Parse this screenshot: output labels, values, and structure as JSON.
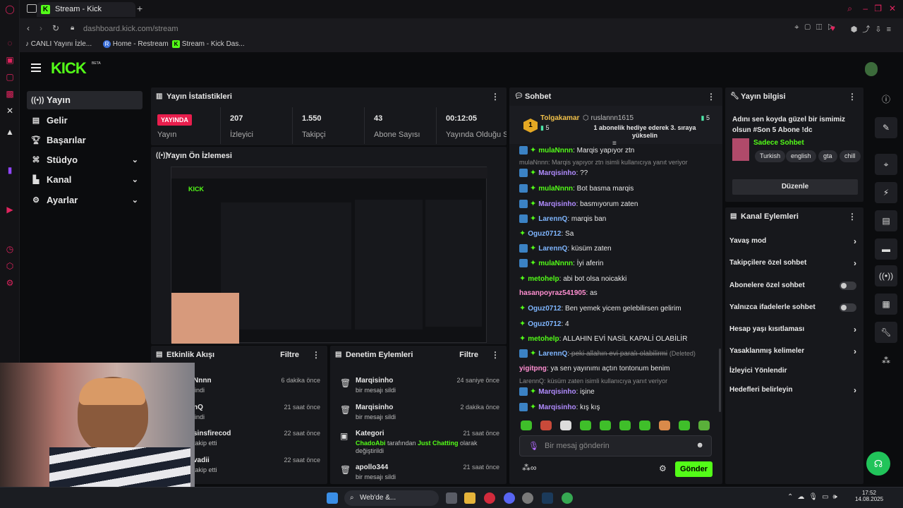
{
  "browser": {
    "tab_title": "Stream - Kick Dashboard",
    "url_host": "dashboard.kick.com",
    "url_path": "/stream",
    "bookmarks": [
      "CANLI Yayını İzle...",
      "Home - Restream",
      "Stream - Kick Das..."
    ]
  },
  "kick": {
    "logo": "KICK",
    "beta": "BETA"
  },
  "nav": {
    "items": [
      {
        "label": "Yayın",
        "icon": "broadcast-icon"
      },
      {
        "label": "Gelir",
        "icon": "revenue-icon"
      },
      {
        "label": "Başarılar",
        "icon": "trophy-icon"
      },
      {
        "label": "Stüdyo",
        "icon": "studio-icon"
      },
      {
        "label": "Kanal",
        "icon": "channel-icon"
      },
      {
        "label": "Ayarlar",
        "icon": "gear-icon"
      }
    ]
  },
  "stats": {
    "title": "Yayın İstatistikleri",
    "live_badge": "YAYINDA",
    "items": [
      {
        "value": "",
        "label": "Yayın"
      },
      {
        "value": "207",
        "label": "İzleyici"
      },
      {
        "value": "1.550",
        "label": "Takipçi"
      },
      {
        "value": "43",
        "label": "Abone Sayısı"
      },
      {
        "value": "00:12:05",
        "label": "Yayında Olduğu Süre"
      }
    ]
  },
  "preview": {
    "title": "Yayın Ön İzlemesi"
  },
  "activity": {
    "title": "Etkinlik Akışı",
    "filter": "Filtre",
    "rows": [
      {
        "name": "Nnnn",
        "sub": "lindi",
        "time": "6 dakika önce"
      },
      {
        "name": "nQ",
        "sub": "lindi",
        "time": "21 saat önce"
      },
      {
        "name": "sinsfirecod",
        "sub": "takip etti",
        "time": "22 saat önce"
      },
      {
        "name": "vadii",
        "sub": "takip etti",
        "time": "22 saat önce"
      }
    ]
  },
  "moderation": {
    "title": "Denetim Eylemleri",
    "filter": "Filtre",
    "rows": [
      {
        "name": "Marqisinho",
        "sub": "bir mesajı sildi",
        "time": "24 saniye önce"
      },
      {
        "name": "Marqisinho",
        "sub": "bir mesajı sildi",
        "time": "2 dakika önce"
      },
      {
        "name": "Kategori",
        "sub_user": "ChadoAbi",
        "sub_mid": " tarafından ",
        "sub_cat": "Just Chatting",
        "sub_end": " olarak değiştirildi",
        "time": "21 saat önce"
      },
      {
        "name": "apollo344",
        "sub": "bir mesajı sildi",
        "time": "21 saat önce"
      }
    ]
  },
  "chat": {
    "title": "Sohbet",
    "gifter": {
      "rank": "1",
      "name": "Tolgakamar",
      "count": "5"
    },
    "gift_user": "ruslannn1615",
    "gift_count": "5",
    "gift_text": "1 abonelik hediye ederek 3. sıraya yükselin",
    "messages": [
      {
        "user": "mulaNnnn",
        "text": " Marqis yapıyor ztn",
        "color": "green"
      },
      {
        "reply": "mulaNnnn: Marqis yapıyor ztn isimli kullanıcıya yanıt veriyor"
      },
      {
        "user": "Marqisinho",
        "text": " ??",
        "color": "purple"
      },
      {
        "user": "mulaNnnn",
        "text": " Bot basma marqis",
        "color": "green"
      },
      {
        "user": "Marqisinho",
        "text": " basmıyorum zaten",
        "color": "purple"
      },
      {
        "user": "LarennQ",
        "text": " marqis ban",
        "color": "blue"
      },
      {
        "user": "Oguz0712",
        "text": " Sa",
        "color": "blue"
      },
      {
        "user": "LarennQ",
        "text": " küsüm zaten",
        "color": "blue"
      },
      {
        "user": "mulaNnnn",
        "text": " İyi aferin",
        "color": "green"
      },
      {
        "user": "metohelp",
        "text": " abi bot olsa noicakki",
        "color": "green"
      },
      {
        "user": "hasanpoyraz541905",
        "text": " as",
        "color": "pink"
      },
      {
        "user": "Oguz0712",
        "text": " Ben yemek yicem gelebilirsen gelirim",
        "color": "blue"
      },
      {
        "user": "Oguz0712",
        "text": " 4",
        "color": "blue"
      },
      {
        "user": "metohelp",
        "text": " ALLAHIN EVİ NASİL KAPALİ OLABİLİR",
        "color": "green"
      },
      {
        "user": "LarennQ",
        "text": " peki allahın evi paralı olabilirmi",
        "deleted": "(Deleted)",
        "color": "blue"
      },
      {
        "user": "yigitpng",
        "text": " ya sen yayınımı açtın tontonum benim",
        "color": "pink"
      },
      {
        "reply": "LarennQ: küsüm zaten isimli kullanıcıya yanıt veriyor"
      },
      {
        "user": "Marqisinho",
        "text": " işine",
        "color": "purple"
      },
      {
        "user": "Marqisinho",
        "text": " kış kış",
        "color": "purple"
      }
    ],
    "input_placeholder": "Bir mesaj gönderin",
    "send": "Gönder"
  },
  "stream_info": {
    "title": "Yayın bilgisi",
    "stream_title": "Adını sen koyda güzel bir ismimiz olsun #Son 5 Abone !dc",
    "category": "Sadece Sohbet",
    "tags": [
      "Turkish",
      "english",
      "gta",
      "chill"
    ],
    "edit": "Düzenle"
  },
  "channel_actions": {
    "title": "Kanal Eylemleri",
    "items": [
      {
        "label": "Yavaş mod",
        "type": "chevron"
      },
      {
        "label": "Takipçilere özel sohbet",
        "type": "chevron"
      },
      {
        "label": "Abonelere özel sohbet",
        "type": "toggle"
      },
      {
        "label": "Yalnızca ifadelerle sohbet",
        "type": "toggle"
      },
      {
        "label": "Hesap yaşı kısıtlaması",
        "type": "chevron"
      },
      {
        "label": "Yasaklanmış kelimeler",
        "type": "chevron"
      },
      {
        "label": "İzleyici Yönlendir",
        "type": "none"
      },
      {
        "label": "Hedefleri belirleyin",
        "type": "chevron"
      }
    ]
  },
  "taskbar": {
    "search": "Web'de &...",
    "time": "17:52",
    "date": "14.08.2025"
  }
}
